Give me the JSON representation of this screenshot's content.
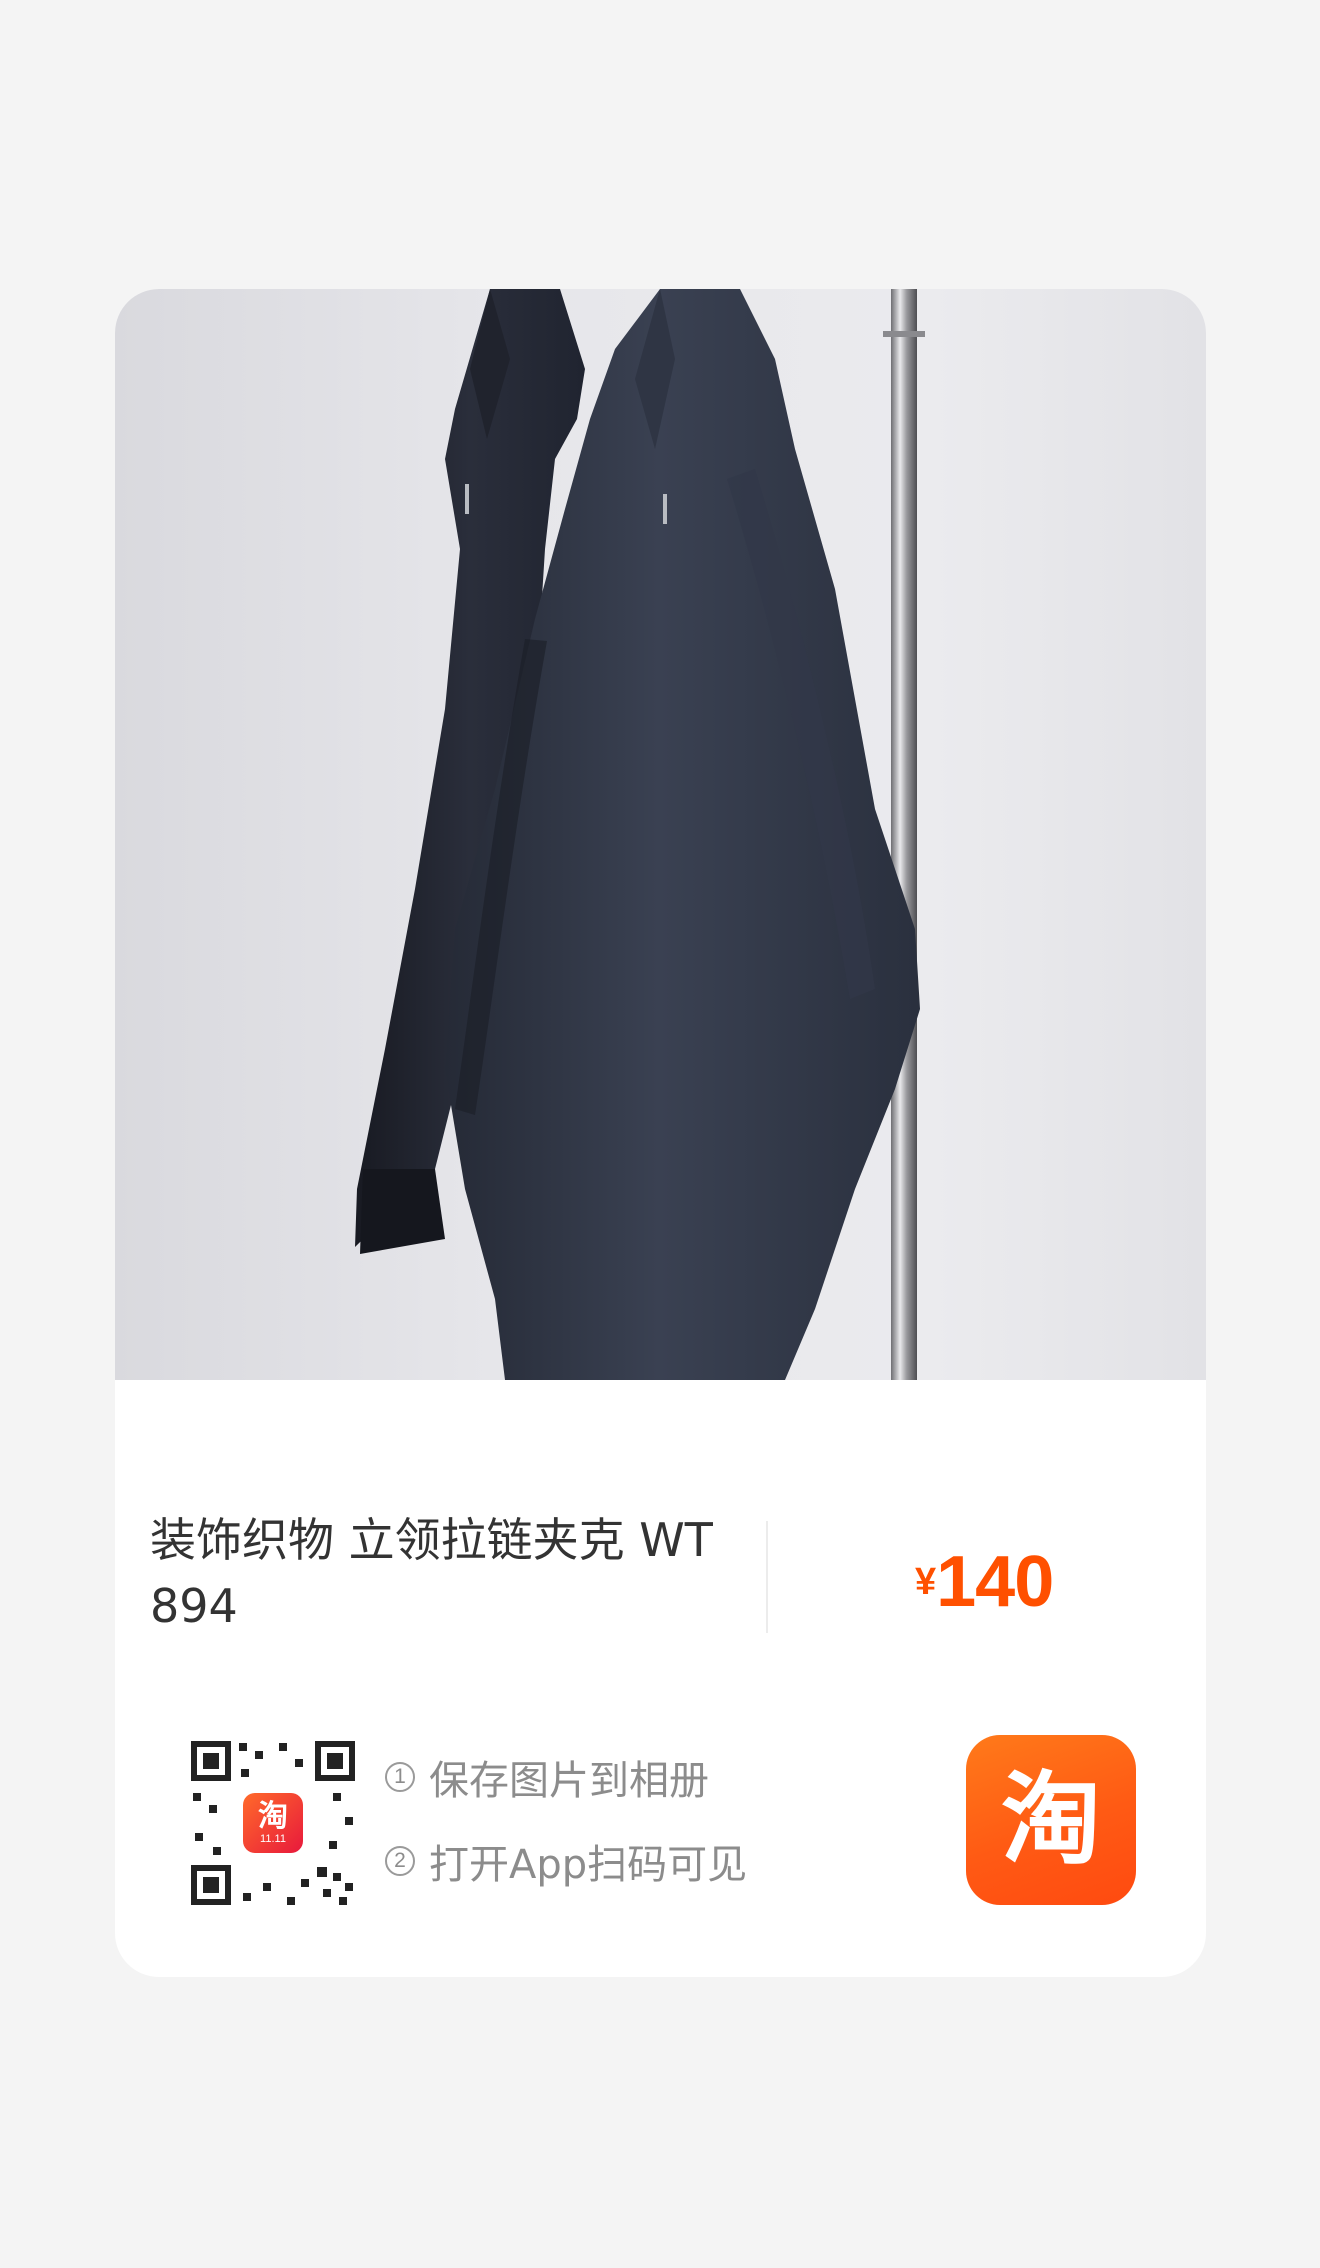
{
  "product": {
    "title": "装饰织物 立领拉链夹克 WT894",
    "currency_symbol": "¥",
    "price": "140",
    "image_icon": "hanging-jackets-photo"
  },
  "share": {
    "step1_number": "1",
    "step1_text": "保存图片到相册",
    "step2_number": "2",
    "step2_text": "打开App扫码可见",
    "qr_badge_text": "淘",
    "qr_badge_sub": "11.11"
  },
  "logo": {
    "text": "淘",
    "color": "#ff5000"
  },
  "colors": {
    "price": "#ff5000",
    "title": "#333333",
    "secondary": "#8c8c8c"
  }
}
